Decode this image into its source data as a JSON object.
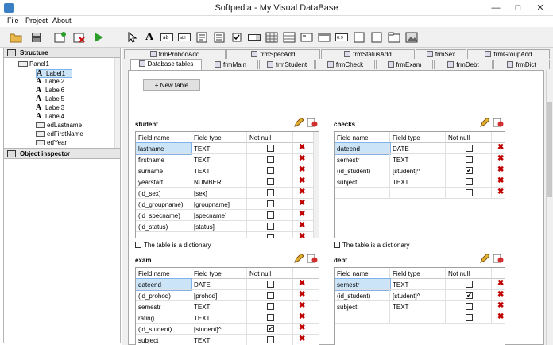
{
  "window": {
    "title": "Softpedia - My Visual DataBase"
  },
  "menu": [
    "File",
    "Project",
    "About"
  ],
  "structure": {
    "header": "Structure",
    "nodes": [
      "Panel1",
      "Label1",
      "Label2",
      "Label6",
      "Label5",
      "Label3",
      "Label4",
      "edLastname",
      "edFirstName",
      "edYear"
    ]
  },
  "inspector": {
    "header": "Object inspector"
  },
  "tabs_back": [
    "frmProhodAdd",
    "frmSpecAdd",
    "frmStatusAdd",
    "frmSex",
    "frmGroupAdd"
  ],
  "tabs_front": [
    "Database tables",
    "frmMain",
    "frmStudent",
    "frmCheck",
    "frmExam",
    "frmDebt",
    "frmDict"
  ],
  "new_table": "+ New table",
  "dictionary_label": "The table is a dictionary",
  "columns": [
    "Field name",
    "Field type",
    "Not null"
  ],
  "tables": {
    "student": {
      "name": "student",
      "rows": [
        {
          "f": "lastname",
          "t": "TEXT",
          "n": false
        },
        {
          "f": "firstname",
          "t": "TEXT",
          "n": false
        },
        {
          "f": "surname",
          "t": "TEXT",
          "n": false
        },
        {
          "f": "yearstart",
          "t": "NUMBER",
          "n": false
        },
        {
          "f": "(id_sex)",
          "t": "[sex]",
          "n": false
        },
        {
          "f": "(id_groupname)",
          "t": "[groupname]",
          "n": false
        },
        {
          "f": "(id_specname)",
          "t": "[specname]",
          "n": false
        },
        {
          "f": "(id_status)",
          "t": "[status]",
          "n": false
        },
        {
          "f": "",
          "t": "",
          "n": false
        }
      ]
    },
    "checks": {
      "name": "checks",
      "rows": [
        {
          "f": "dateend",
          "t": "DATE",
          "n": false
        },
        {
          "f": "semestr",
          "t": "TEXT",
          "n": false
        },
        {
          "f": "(id_student)",
          "t": "[student]^",
          "n": true
        },
        {
          "f": "subject",
          "t": "TEXT",
          "n": false
        },
        {
          "f": "",
          "t": "",
          "n": false
        }
      ]
    },
    "exam": {
      "name": "exam",
      "rows": [
        {
          "f": "dateend",
          "t": "DATE",
          "n": false
        },
        {
          "f": "(id_prohod)",
          "t": "[prohod]",
          "n": false
        },
        {
          "f": "semestr",
          "t": "TEXT",
          "n": false
        },
        {
          "f": "rating",
          "t": "TEXT",
          "n": false
        },
        {
          "f": "(id_student)",
          "t": "[student]^",
          "n": true
        },
        {
          "f": "subject",
          "t": "TEXT",
          "n": false
        },
        {
          "f": "",
          "t": "",
          "n": false
        }
      ]
    },
    "debt": {
      "name": "debt",
      "rows": [
        {
          "f": "semestr",
          "t": "TEXT",
          "n": false
        },
        {
          "f": "(id_student)",
          "t": "[student]^",
          "n": true
        },
        {
          "f": "subject",
          "t": "TEXT",
          "n": false
        },
        {
          "f": "",
          "t": "",
          "n": false
        }
      ]
    }
  }
}
